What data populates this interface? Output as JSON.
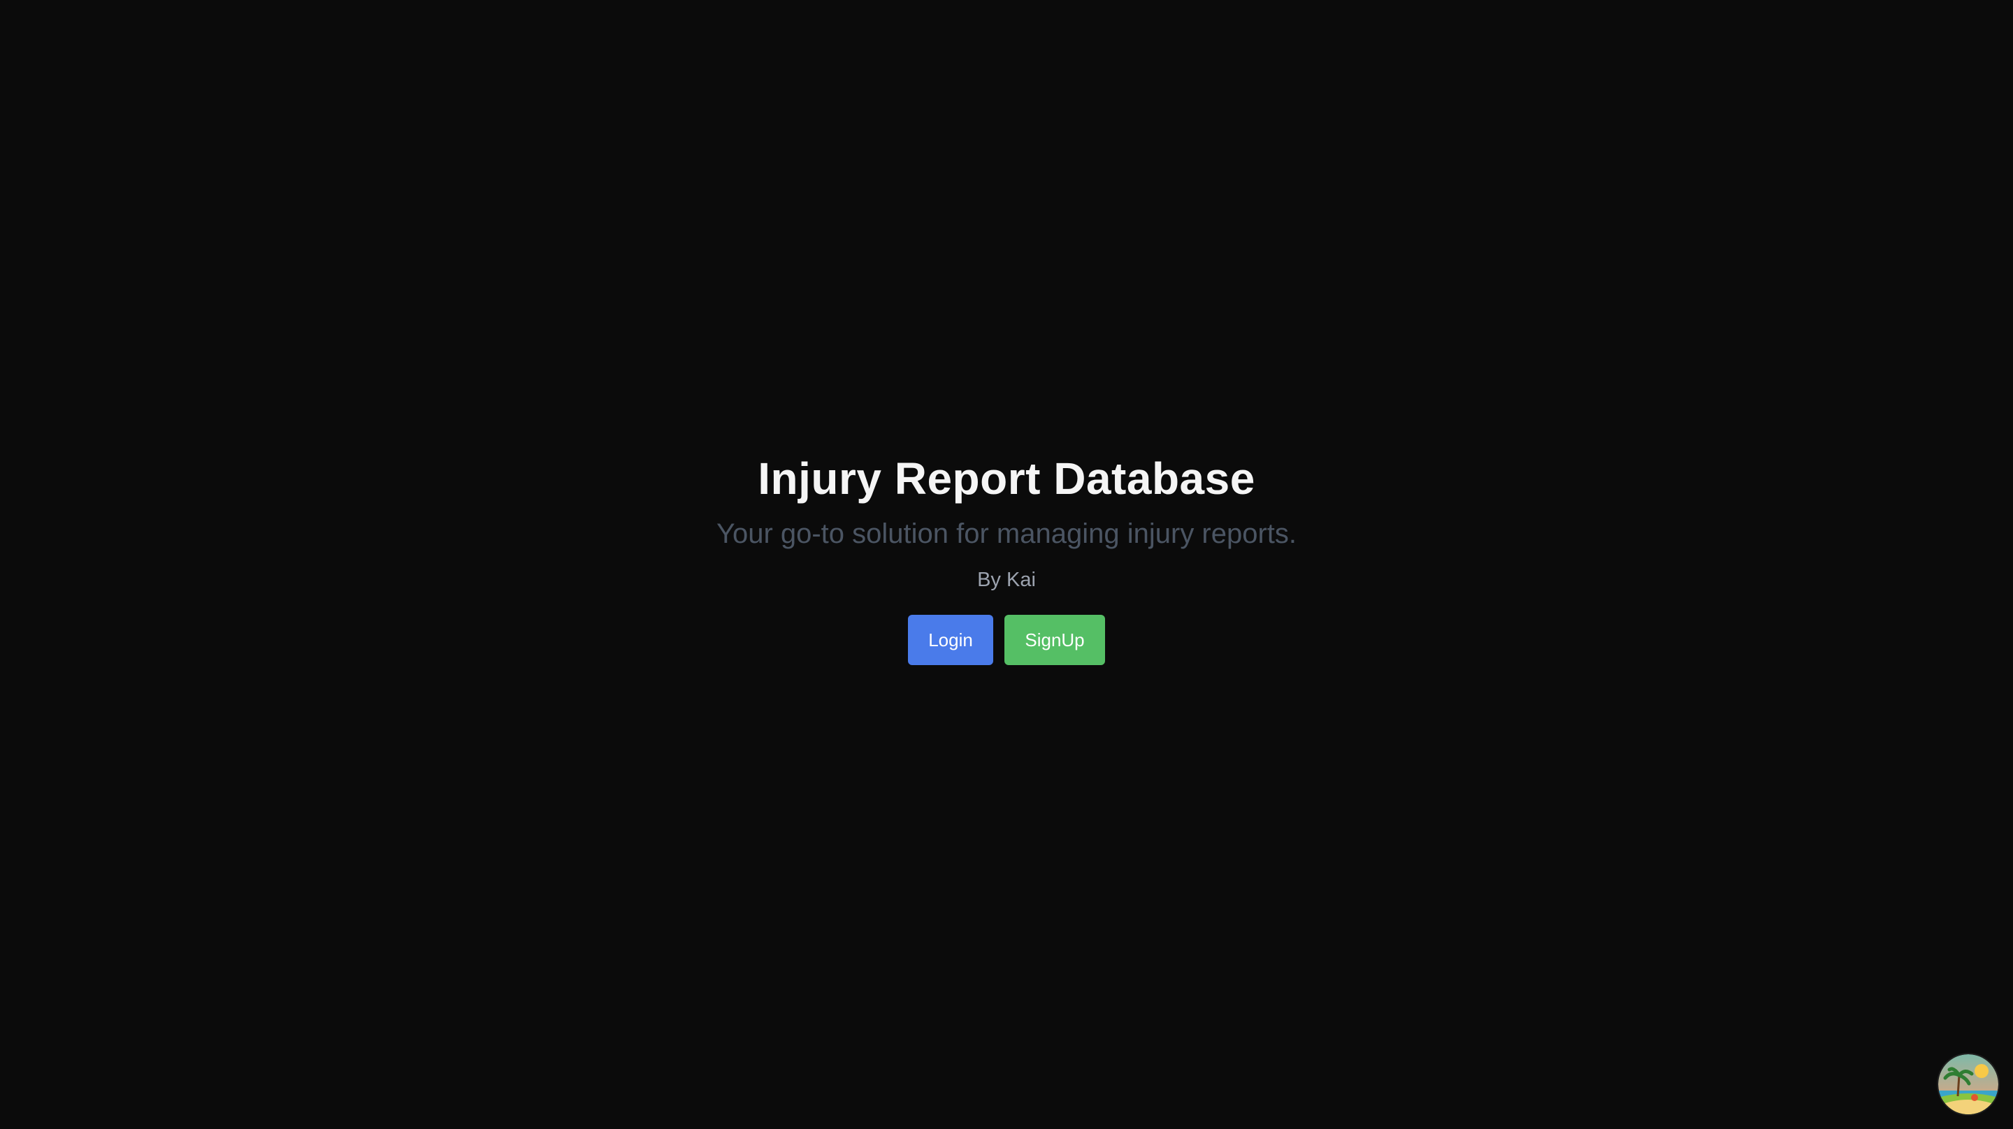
{
  "hero": {
    "title": "Injury Report Database",
    "subtitle": "Your go-to solution for managing injury reports.",
    "byline": "By Kai"
  },
  "actions": {
    "login_label": "Login",
    "signup_label": "SignUp"
  },
  "colors": {
    "background": "#0b0b0b",
    "login": "#4a7bea",
    "signup": "#55bf65"
  },
  "avatar": {
    "icon": "tropical-beach-avatar-icon"
  }
}
